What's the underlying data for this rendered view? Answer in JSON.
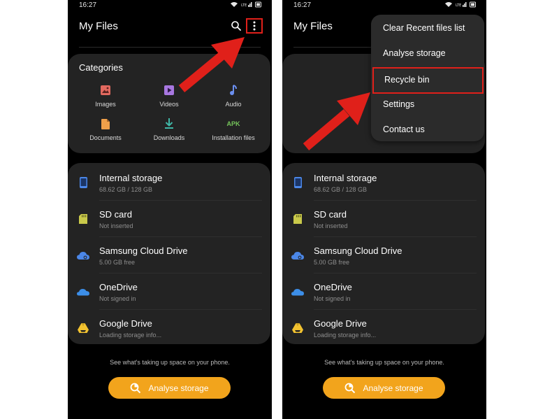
{
  "phones": [
    {
      "status_time": "16:27",
      "status_net": "Vo)) LTE1 LTE2",
      "app_title": "My Files",
      "categories": {
        "title": "Categories",
        "items": [
          {
            "label": "Images",
            "icon": "images-icon",
            "color": "#e2695f"
          },
          {
            "label": "Videos",
            "icon": "videos-icon",
            "color": "#a777e0"
          },
          {
            "label": "Audio",
            "icon": "audio-icon",
            "color": "#6b8ff0"
          },
          {
            "label": "Documents",
            "icon": "documents-icon",
            "color": "#f0a04a"
          },
          {
            "label": "Downloads",
            "icon": "downloads-icon",
            "color": "#3fb7a7"
          },
          {
            "label": "Installation files",
            "icon": "apk-icon",
            "icon_text": "APK",
            "color": "#74c35a"
          }
        ]
      },
      "storage": [
        {
          "name": "Internal storage",
          "sub": "68.62 GB / 128 GB",
          "icon": "phone-icon",
          "color": "#4b87e8"
        },
        {
          "name": "SD card",
          "sub": "Not inserted",
          "icon": "sd-card-icon",
          "color": "#c9c94a"
        },
        {
          "name": "Samsung Cloud Drive",
          "sub": "5.00 GB free",
          "icon": "cloud-icon",
          "color": "#4b87e8"
        },
        {
          "name": "OneDrive",
          "sub": "Not signed in",
          "icon": "onedrive-icon",
          "color": "#3c8ee8"
        },
        {
          "name": "Google Drive",
          "sub": "Loading storage info...",
          "icon": "google-drive-icon",
          "color": "#f2c230"
        }
      ],
      "footnote": "See what's taking up space on your phone.",
      "analyse_button": "Analyse storage"
    },
    {
      "status_time": "16:27",
      "status_net": "Vo)) LTE1 LTE2",
      "app_title": "My Files",
      "menu": [
        {
          "label": "Clear Recent files list"
        },
        {
          "label": "Analyse storage"
        },
        {
          "label": "Recycle bin",
          "highlighted": true
        },
        {
          "label": "Settings"
        },
        {
          "label": "Contact us"
        }
      ],
      "storage": [
        {
          "name": "Internal storage",
          "sub": "68.62 GB / 128 GB",
          "icon": "phone-icon",
          "color": "#4b87e8"
        },
        {
          "name": "SD card",
          "sub": "Not inserted",
          "icon": "sd-card-icon",
          "color": "#c9c94a"
        },
        {
          "name": "Samsung Cloud Drive",
          "sub": "5.00 GB free",
          "icon": "cloud-icon",
          "color": "#4b87e8"
        },
        {
          "name": "OneDrive",
          "sub": "Not signed in",
          "icon": "onedrive-icon",
          "color": "#3c8ee8"
        },
        {
          "name": "Google Drive",
          "sub": "Loading storage info...",
          "icon": "google-drive-icon",
          "color": "#f2c230"
        }
      ],
      "footnote": "See what's taking up space on your phone.",
      "analyse_button": "Analyse storage"
    }
  ],
  "colors": {
    "highlight": "#e0201a",
    "arrow": "#e0201a",
    "accent_button": "#f2a41c",
    "card": "#232323",
    "screen_bg": "#000000"
  }
}
